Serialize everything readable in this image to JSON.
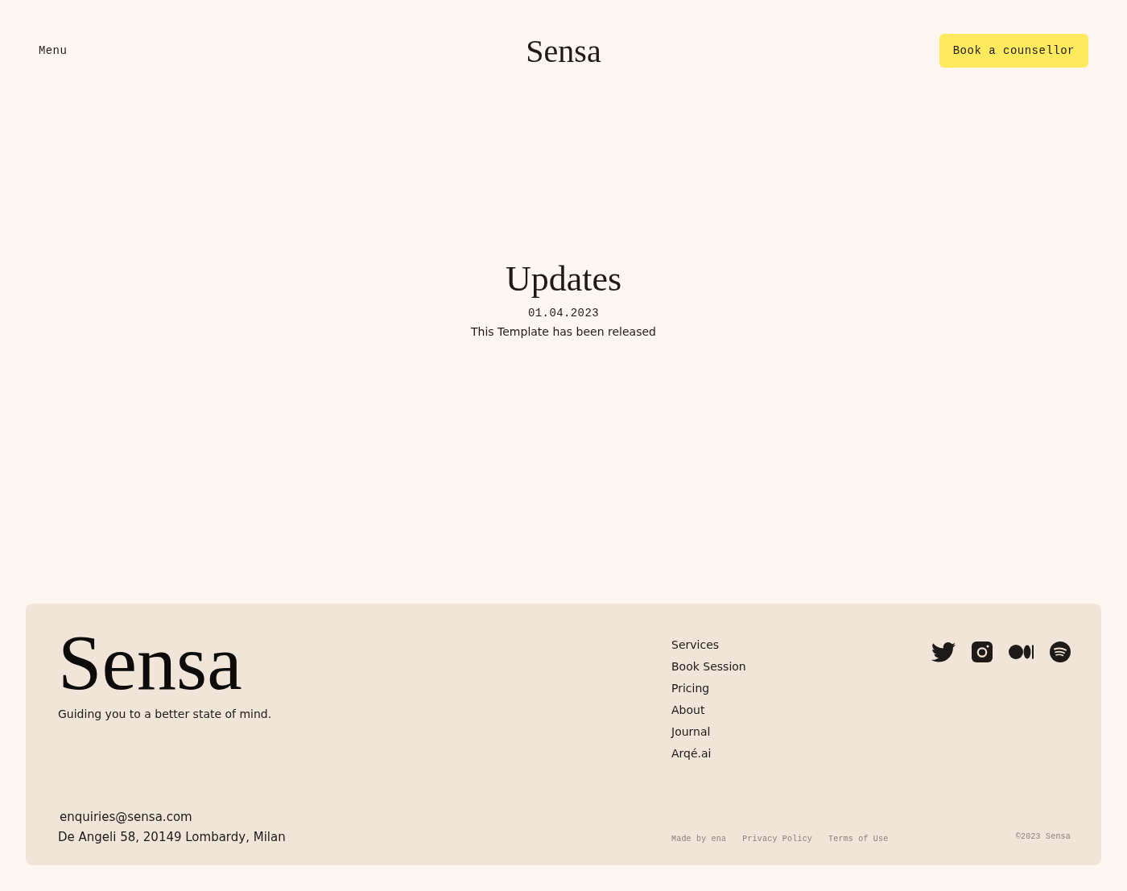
{
  "header": {
    "menu": "Menu",
    "logo": "Sensa",
    "cta": "Book a counsellor"
  },
  "main": {
    "title": "Updates",
    "date": "01.04.2023",
    "text": "This Template has been released"
  },
  "footer": {
    "logo": "Sensa",
    "tagline": "Guiding you to a better state of mind.",
    "nav": [
      "Services",
      "Book Session",
      "Pricing",
      "About",
      "Journal",
      "Arqé.ai"
    ],
    "socials": [
      {
        "kind": "bird"
      },
      {
        "kind": "camera"
      },
      {
        "kind": "ovals"
      },
      {
        "kind": "arcs"
      }
    ],
    "email": "enquiries@sensa.com",
    "address": "De Angeli 58, 20149 Lombardy, Milan",
    "legal": [
      "Made by ena",
      "Privacy Policy",
      "Terms of Use"
    ],
    "copyright": "©2023 Sensa"
  }
}
